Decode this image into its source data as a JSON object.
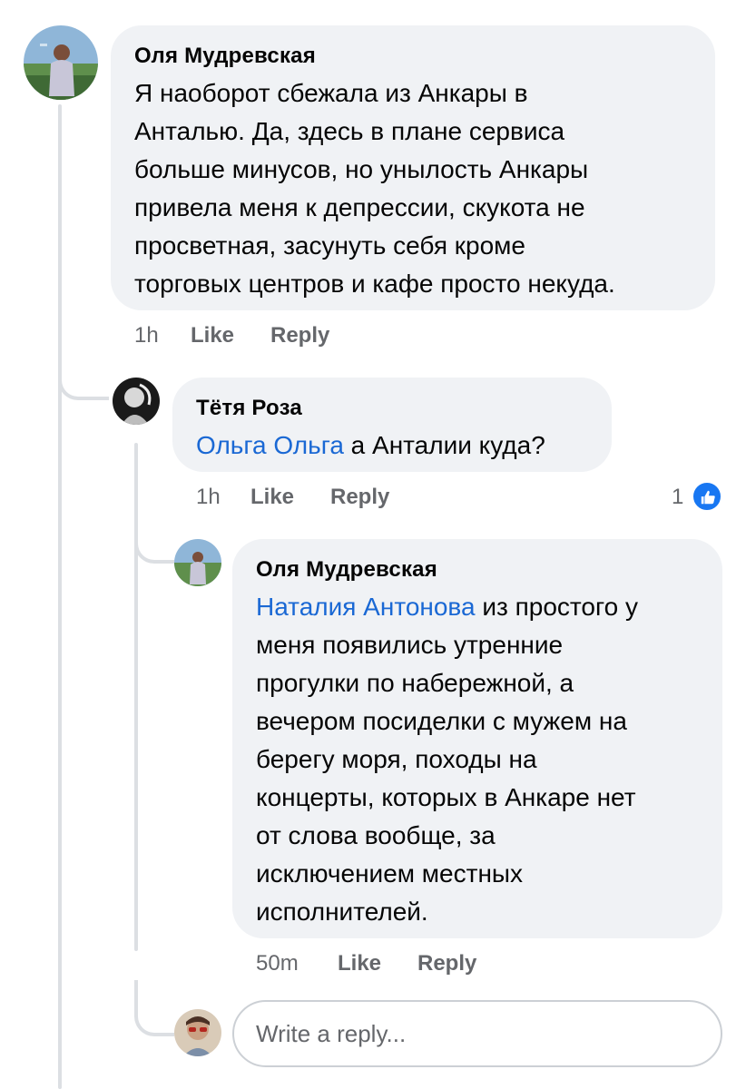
{
  "comments": [
    {
      "author": "Оля Мудревская",
      "text": "Я наоборот сбежала из Анкары в Анталью. Да, здесь в плане сервиса больше минусов, но унылость Анкары привела меня к депрессии, скукота не просветная, засунуть себя кроме торговых центров и кафе просто некуда.",
      "lines": [
        "Я наоборот сбежала из Анкары в",
        "Анталью. Да, здесь в плане сервиса",
        "больше минусов, но унылость Анкары",
        "привела меня к депрессии, скукота не",
        "просветная, засунуть себя кроме",
        "торговых центров и кафе просто некуда."
      ],
      "time": "1h",
      "like_label": "Like",
      "reply_label": "Reply"
    },
    {
      "author": "Тётя Роза",
      "mention": "Ольга Ольга",
      "text": " а Анталии куда?",
      "time": "1h",
      "like_label": "Like",
      "reply_label": "Reply",
      "reaction_count": "1"
    },
    {
      "author": "Оля Мудревская",
      "mention": "Наталия Антонова",
      "text": " из простого у меня появились утренние прогулки по набережной, а вечером посиделки с мужем на берегу моря, походы на концерты, которых в Анкаре нет от слова вообще, за исключением местных исполнителей.",
      "lines": [
        " из простого у",
        "меня появились утренние",
        "прогулки по набережной, а",
        "вечером посиделки с мужем на",
        "берегу моря, походы на",
        "концерты, которых в Анкаре нет",
        "от слова вообще, за",
        "исключением местных",
        "исполнителей."
      ],
      "time": "50m",
      "like_label": "Like",
      "reply_label": "Reply"
    }
  ],
  "reply_box": {
    "placeholder": "Write a reply..."
  },
  "colors": {
    "bubble": "#f0f2f5",
    "mention": "#1a68d4",
    "meta": "#65676b",
    "like_badge": "#1877f2",
    "thread_line": "#dcdfe3"
  },
  "icons": {
    "reaction": "thumbs-up-icon"
  }
}
